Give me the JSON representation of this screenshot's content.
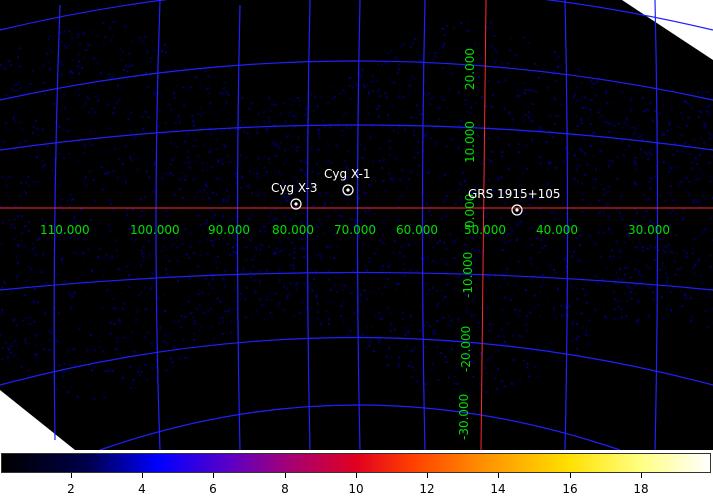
{
  "sources": [
    {
      "name": "Cyg X-3",
      "l": 79.8,
      "b": 0.7
    },
    {
      "name": "Cyg X-1",
      "l": 71.3,
      "b": 3.1
    },
    {
      "name": "GRS 1915+105",
      "l": 45.4,
      "b": -0.2
    }
  ],
  "axes": {
    "l_labels": [
      "110.000",
      "100.000",
      "90.000",
      "80.000",
      "70.000",
      "60.000",
      "50.000",
      "40.000",
      "30.000"
    ],
    "b_labels": [
      "20.000",
      "10.000",
      "0.000",
      "-10.000",
      "-20.000",
      "-30.000"
    ]
  },
  "colorbar": {
    "labels": [
      "2",
      "4",
      "6",
      "8",
      "10",
      "12",
      "14",
      "16",
      "18"
    ],
    "min": 0,
    "max": 20
  },
  "colors": {
    "grid": "#2020ff",
    "axis": "#ff2a2a",
    "label": "#00e000",
    "marker": "#ffffff",
    "background": "#000000"
  }
}
